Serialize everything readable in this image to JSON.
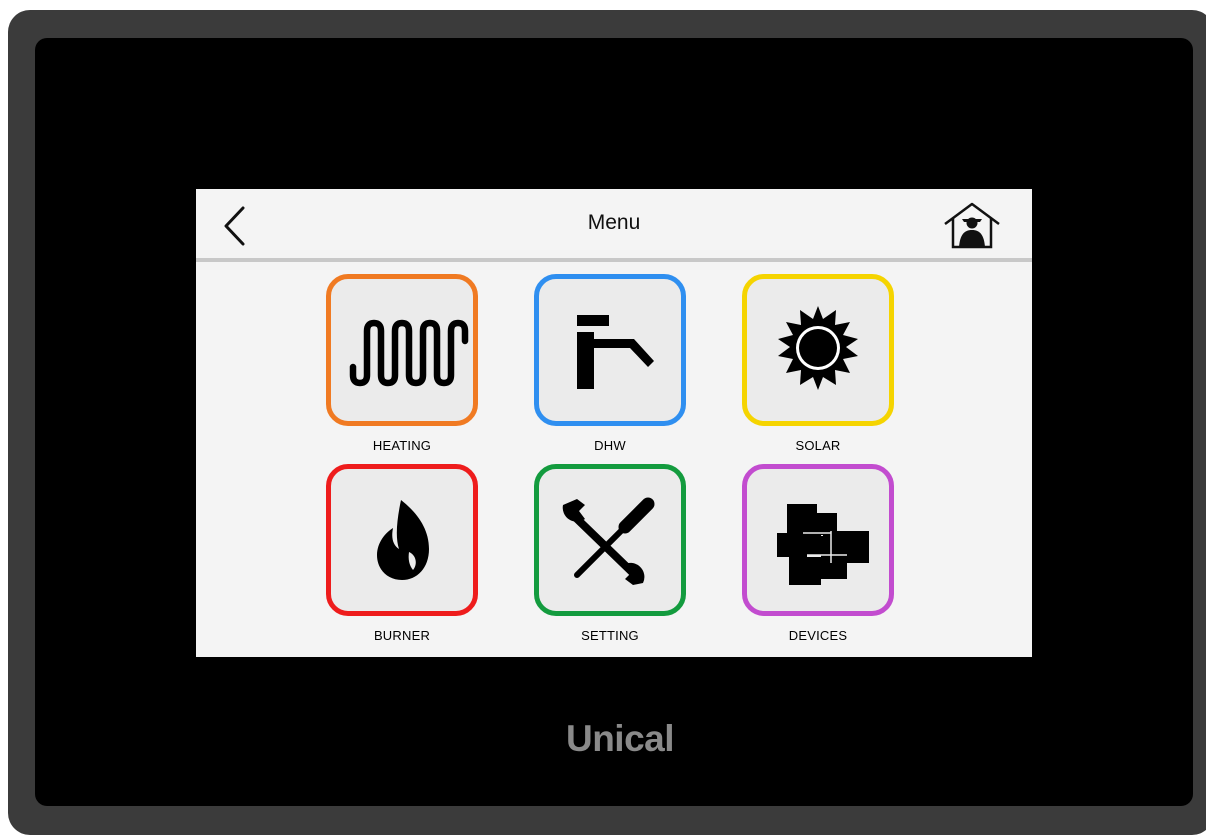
{
  "header": {
    "title": "Menu",
    "back_icon": "chevron-left-icon",
    "home_icon": "house-person-icon"
  },
  "menu_items": [
    {
      "label": "HEATING",
      "icon": "radiator-icon",
      "border_color": "#f07a22"
    },
    {
      "label": "DHW",
      "icon": "faucet-icon",
      "border_color": "#2f8ff0"
    },
    {
      "label": "SOLAR",
      "icon": "sun-icon",
      "border_color": "#f5d400"
    },
    {
      "label": "BURNER",
      "icon": "flame-icon",
      "border_color": "#ee1c1c"
    },
    {
      "label": "SETTING",
      "icon": "wrench-screwdriver-icon",
      "border_color": "#139b3e"
    },
    {
      "label": "DEVICES",
      "icon": "devices-blocks-icon",
      "border_color": "#c24ccf"
    }
  ],
  "brand": {
    "name": "Unical"
  }
}
